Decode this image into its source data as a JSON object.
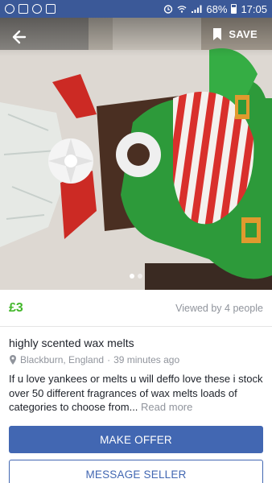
{
  "status_bar": {
    "battery": "68%",
    "time": "17:05",
    "left_icons": [
      "whatsapp-icon",
      "gallery-icon",
      "messenger-icon",
      "photos-icon"
    ],
    "right_icons": [
      "alarm-icon",
      "wifi-icon",
      "signal-icon",
      "battery-icon"
    ],
    "background": "#3b5998"
  },
  "header": {
    "save_label": "SAVE",
    "back_icon": "back-arrow-icon",
    "save_icon": "bookmark-icon"
  },
  "gallery": {
    "photo_count": 2,
    "current_index": 0
  },
  "listing": {
    "price": "£3",
    "viewed": "Viewed by 4 people",
    "title": "highly scented wax melts",
    "location": "Blackburn, England",
    "posted": "39 minutes ago",
    "location_separator": " · ",
    "description": "If u love yankees or melts u will deffo love these i stock over 50 different fragrances  of  wax melts loads of categories to choose from...",
    "read_more": "Read more"
  },
  "actions": {
    "make_offer": "MAKE OFFER",
    "message_seller": "MESSAGE SELLER"
  },
  "colors": {
    "brand": "#4267b2",
    "price": "#42b72a",
    "muted": "#90949c"
  }
}
